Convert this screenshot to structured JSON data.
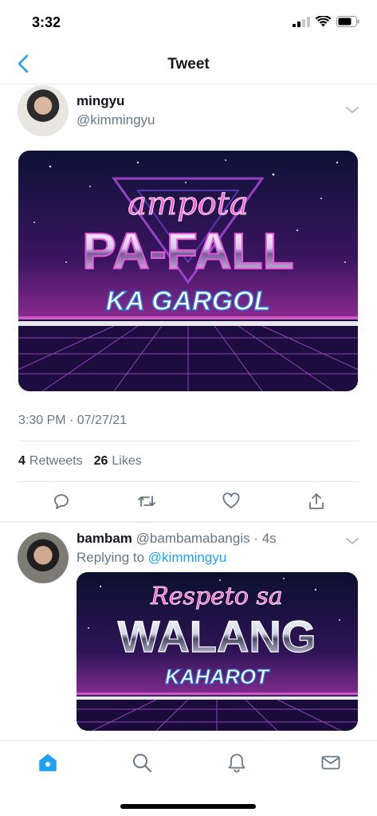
{
  "status_bar": {
    "time": "3:32"
  },
  "header": {
    "title": "Tweet"
  },
  "tweet": {
    "display_name": "mingyu",
    "handle": "@kimmingyu",
    "image": {
      "top_text": "ampota",
      "main_text": "PA-FALL",
      "sub_text": "KA GARGOL"
    },
    "timestamp": "3:30 PM · 07/27/21",
    "retweets": "4",
    "retweets_label": "Retweets",
    "likes": "26",
    "likes_label": "Likes"
  },
  "reply": {
    "display_name": "bambam",
    "handle_time": "@bambamabangis · 4s",
    "replying_prefix": "Replying to",
    "replying_to": "@kimmingyu",
    "image": {
      "top_text": "Respeto sa",
      "main_text": "WALANG",
      "sub_text": "KAHAROT"
    }
  },
  "colors": {
    "accent": "#1da1f2",
    "secondary_text": "#657786",
    "divider": "#e1e8ed"
  },
  "icons": [
    "back-chevron-icon",
    "reply-icon",
    "retweet-icon",
    "like-icon",
    "share-icon",
    "home-icon",
    "search-icon",
    "notifications-icon",
    "messages-icon"
  ]
}
